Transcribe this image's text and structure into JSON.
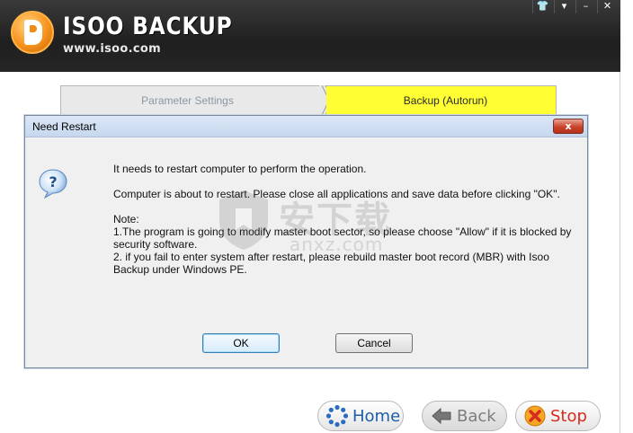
{
  "app": {
    "logo_title": "ISOO BACKUP",
    "logo_url": "www.isoo.com",
    "window_controls": {
      "skin": "👕",
      "menu": "▾",
      "minimize": "–",
      "close": "✕"
    }
  },
  "tabs": [
    {
      "label": "Parameter Settings",
      "active": false
    },
    {
      "label": "Backup (Autorun)",
      "active": true
    }
  ],
  "dialog": {
    "title": "Need Restart",
    "close_label": "x",
    "icon": "question-icon",
    "lines": {
      "line1": "It needs to restart computer to perform the operation.",
      "line2": "Computer is about to restart. Please close all applications and save data before clicking \"OK\".",
      "note_heading": "Note:",
      "note1": " 1.The program is going to modify master boot sector, so please choose \"Allow\" if it is blocked by security software.",
      "note2": " 2. if you fail to enter system after restart, please rebuild master boot record (MBR) with Isoo Backup under Windows PE."
    },
    "ok_label": "OK",
    "cancel_label": "Cancel"
  },
  "watermark": {
    "cn": "安下载",
    "url": "anxz.com"
  },
  "nav": {
    "home_label": "Home",
    "back_label": "Back",
    "stop_label": "Stop"
  },
  "colors": {
    "header_bg": "#262626",
    "active_tab": "#ffff33",
    "home_text": "#1c5ea8",
    "stop_text": "#d62b1e",
    "dialog_close": "#c9432a"
  }
}
